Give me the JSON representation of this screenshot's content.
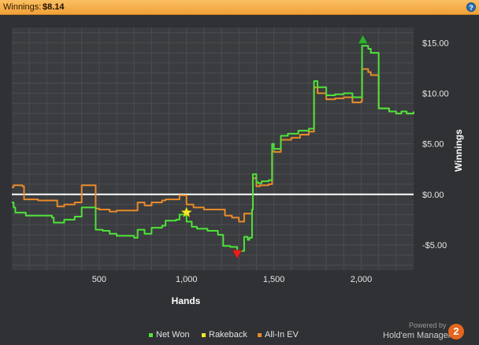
{
  "header": {
    "label": "Winnings:",
    "value": "$8.14",
    "help": "?"
  },
  "colors": {
    "net_won": "#4fe23a",
    "rakeback": "#f2ea2a",
    "all_in_ev": "#e88a2a",
    "zero_line": "#ffffff"
  },
  "branding": {
    "powered_by": "Powered by",
    "product": "Hold'em Manager",
    "badge": "2"
  },
  "chart_data": {
    "type": "line",
    "xlabel": "Hands",
    "ylabel": "Winnings",
    "xlim": [
      0,
      2300
    ],
    "ylim": [
      -7.5,
      16.5
    ],
    "xticks": [
      500,
      1000,
      1500,
      2000
    ],
    "xtick_labels": [
      "500",
      "1,000",
      "1,500",
      "2,000"
    ],
    "yticks": [
      -5,
      0,
      5,
      10,
      15
    ],
    "ytick_labels": [
      "-$5.00",
      "$0.00",
      "$5.00",
      "$10.00",
      "$15.00"
    ],
    "grid": true,
    "legend": "bottom-center",
    "series": [
      {
        "name": "Net Won",
        "x": [
          0,
          10,
          20,
          80,
          150,
          230,
          240,
          300,
          360,
          400,
          480,
          520,
          560,
          600,
          700,
          720,
          760,
          800,
          860,
          880,
          940,
          960,
          1000,
          1030,
          1060,
          1120,
          1180,
          1210,
          1250,
          1290,
          1330,
          1350,
          1360,
          1375,
          1380,
          1400,
          1410,
          1430,
          1470,
          1490,
          1500,
          1540,
          1580,
          1640,
          1700,
          1730,
          1750,
          1800,
          1850,
          1900,
          1950,
          2000,
          2005,
          2040,
          2055,
          2100,
          2160,
          2200,
          2230,
          2260,
          2300
        ],
        "y": [
          -0.8,
          -1.3,
          -1.8,
          -2.1,
          -2.1,
          -2.3,
          -2.8,
          -2.5,
          -2.2,
          -1.3,
          -3.5,
          -3.6,
          -3.9,
          -4.1,
          -4.3,
          -3.5,
          -3.9,
          -3.3,
          -3.1,
          -2.6,
          -2.5,
          -2.0,
          -2.7,
          -3.2,
          -3.4,
          -3.6,
          -4.0,
          -5.1,
          -5.2,
          -5.6,
          -4.2,
          -4.5,
          -4.3,
          -1.5,
          2.0,
          1.2,
          1.1,
          1.3,
          1.4,
          5.0,
          4.5,
          5.8,
          6.0,
          6.3,
          6.5,
          11.2,
          10.6,
          9.8,
          9.9,
          10.0,
          9.6,
          9.6,
          14.7,
          14.4,
          14.0,
          8.5,
          8.2,
          8.0,
          8.2,
          8.0,
          8.2
        ]
      },
      {
        "name": "Rakeback",
        "x": [],
        "y": []
      },
      {
        "name": "All-In EV",
        "x": [
          0,
          10,
          60,
          70,
          150,
          230,
          260,
          300,
          360,
          400,
          480,
          500,
          560,
          600,
          700,
          720,
          760,
          800,
          860,
          880,
          940,
          960,
          1000,
          1040,
          1100,
          1180,
          1220,
          1260,
          1300,
          1330,
          1350,
          1375,
          1380,
          1400,
          1420,
          1470,
          1490,
          1500,
          1540,
          1600,
          1650,
          1700,
          1730,
          1750,
          1800,
          1850,
          1900,
          1950,
          2000,
          2005,
          2040,
          2055,
          2100,
          2160,
          2200,
          2230,
          2260,
          2300
        ],
        "y": [
          0.7,
          0.9,
          0.8,
          -0.5,
          -0.6,
          -0.6,
          -1.2,
          -1.0,
          -0.8,
          0.9,
          -1.4,
          -1.5,
          -1.7,
          -1.6,
          -1.6,
          -0.8,
          -1.1,
          -0.8,
          -0.6,
          -0.5,
          -0.5,
          -0.1,
          -1.0,
          -1.3,
          -1.5,
          -1.5,
          -2.1,
          -2.3,
          -2.7,
          -1.9,
          -1.9,
          -1.5,
          1.6,
          0.8,
          0.9,
          1.0,
          4.3,
          4.2,
          5.4,
          5.6,
          5.9,
          6.2,
          10.6,
          10.0,
          9.4,
          9.5,
          9.6,
          9.1,
          9.2,
          12.4,
          12.1,
          11.8,
          8.5,
          8.2,
          8.0,
          8.2,
          8.0,
          8.2
        ]
      }
    ],
    "annotations": [
      {
        "type": "star",
        "x": 1000,
        "y": -1.8,
        "color": "#f2ea2a"
      },
      {
        "type": "triangle-down",
        "x": 1290,
        "y": -5.9,
        "color": "#e81e1e"
      },
      {
        "type": "triangle-up",
        "x": 2010,
        "y": 15.3,
        "color": "#2fae2f"
      }
    ]
  }
}
